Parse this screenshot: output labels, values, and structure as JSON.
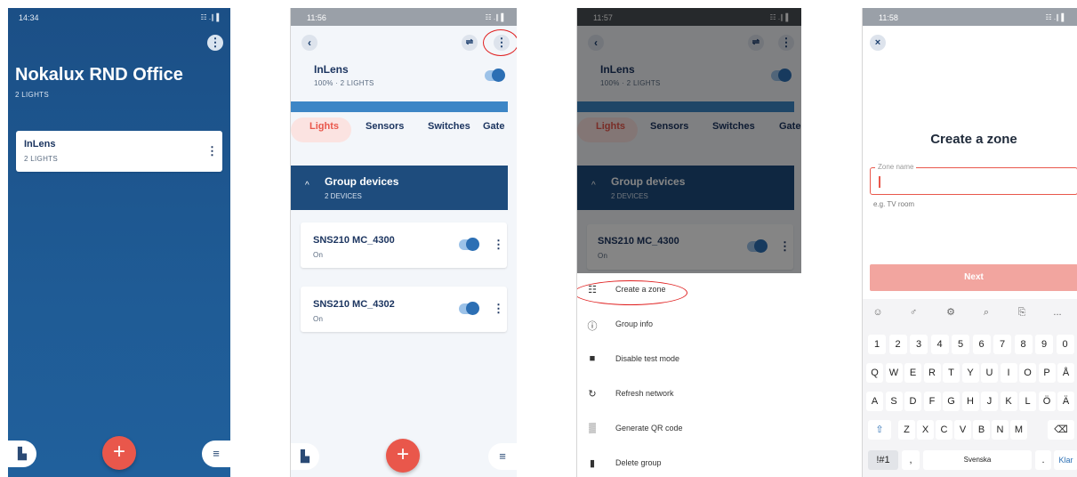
{
  "screen1": {
    "time": "14:34",
    "status_icons": "☷ .∥ ▌",
    "title": "Nokalux RND Office",
    "subtitle": "2 LIGHTS",
    "group": {
      "name": "InLens",
      "sub": "2 LIGHTS"
    }
  },
  "screen2": {
    "time": "11:56",
    "status_icons": "☷ .∥ ▌",
    "group_name": "InLens",
    "group_sub": "100% · 2 LIGHTS",
    "tabs": [
      "Lights",
      "Sensors",
      "Switches",
      "Gate"
    ],
    "section_title": "Group devices",
    "section_sub": "2 DEVICES",
    "devices": [
      {
        "name": "SNS210 MC_4300",
        "status": "On"
      },
      {
        "name": "SNS210 MC_4302",
        "status": "On"
      }
    ]
  },
  "screen3": {
    "time": "11:57",
    "status_icons": "☷ .∥ ▌",
    "group_name": "InLens",
    "group_sub": "100% · 2 LIGHTS",
    "tabs": [
      "Lights",
      "Sensors",
      "Switches",
      "Gate"
    ],
    "section_title": "Group devices",
    "section_sub": "2 DEVICES",
    "device": {
      "name": "SNS210 MC_4300",
      "status": "On"
    },
    "menu": [
      {
        "icon": "zone-icon",
        "glyph": "☷",
        "label": "Create a zone"
      },
      {
        "icon": "info-icon",
        "glyph": "ⓘ",
        "label": "Group info"
      },
      {
        "icon": "sim-card-icon",
        "glyph": "■",
        "label": "Disable test mode"
      },
      {
        "icon": "refresh-icon",
        "glyph": "↻",
        "label": "Refresh network"
      },
      {
        "icon": "qr-code-icon",
        "glyph": "▒",
        "label": "Generate QR code"
      },
      {
        "icon": "trash-icon",
        "glyph": "▮",
        "label": "Delete group"
      }
    ]
  },
  "screen4": {
    "time": "11:58",
    "status_icons": "☷ .∥ ▌",
    "title": "Create a zone",
    "field_label": "Zone name",
    "field_hint": "e.g. TV room",
    "next_label": "Next",
    "keyboard": {
      "toolbar": [
        "☺",
        "♂",
        "⚙",
        "⌕",
        "⎘",
        "..."
      ],
      "row1": [
        "1",
        "2",
        "3",
        "4",
        "5",
        "6",
        "7",
        "8",
        "9",
        "0"
      ],
      "row2": [
        "Q",
        "W",
        "E",
        "R",
        "T",
        "Y",
        "U",
        "I",
        "O",
        "P",
        "Å"
      ],
      "row3": [
        "A",
        "S",
        "D",
        "F",
        "G",
        "H",
        "J",
        "K",
        "L",
        "Ö",
        "Ä"
      ],
      "row4": [
        "⇧",
        "Z",
        "X",
        "C",
        "V",
        "B",
        "N",
        "M",
        "⌫"
      ],
      "sym": "!#1",
      "comma": ",",
      "space": "Svenska",
      "period": ".",
      "enter": "Klar"
    }
  },
  "colors": {
    "brand_blue": "#1b4f86",
    "accent_red": "#e9574b",
    "next_disabled": "#f2a59f",
    "toggle_on": "#2c6fb4"
  }
}
